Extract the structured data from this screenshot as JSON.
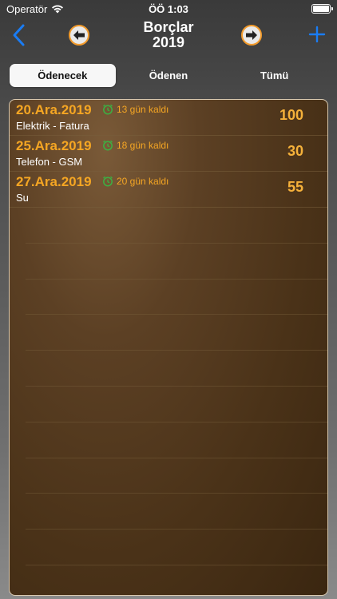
{
  "status_bar": {
    "carrier": "Operatör",
    "time": "ÖÖ 1:03"
  },
  "nav": {
    "title_line1": "Borçlar",
    "title_line2": "2019"
  },
  "segments": [
    {
      "label": "Ödenecek",
      "active": true
    },
    {
      "label": "Ödenen",
      "active": false
    },
    {
      "label": "Tümü",
      "active": false
    }
  ],
  "debts": [
    {
      "date": "20.Ara.2019",
      "remaining": "13 gün kaldı",
      "description": "Elektrik - Fatura",
      "amount": "100"
    },
    {
      "date": "25.Ara.2019",
      "remaining": "18 gün kaldı",
      "description": "Telefon - GSM",
      "amount": "30"
    },
    {
      "date": "27.Ara.2019",
      "remaining": "20 gün kaldı",
      "description": "Su",
      "amount": "55"
    }
  ],
  "colors": {
    "accent": "#f5a623",
    "nav_blue": "#1a7cf4",
    "clock_green": "#3cb043"
  }
}
